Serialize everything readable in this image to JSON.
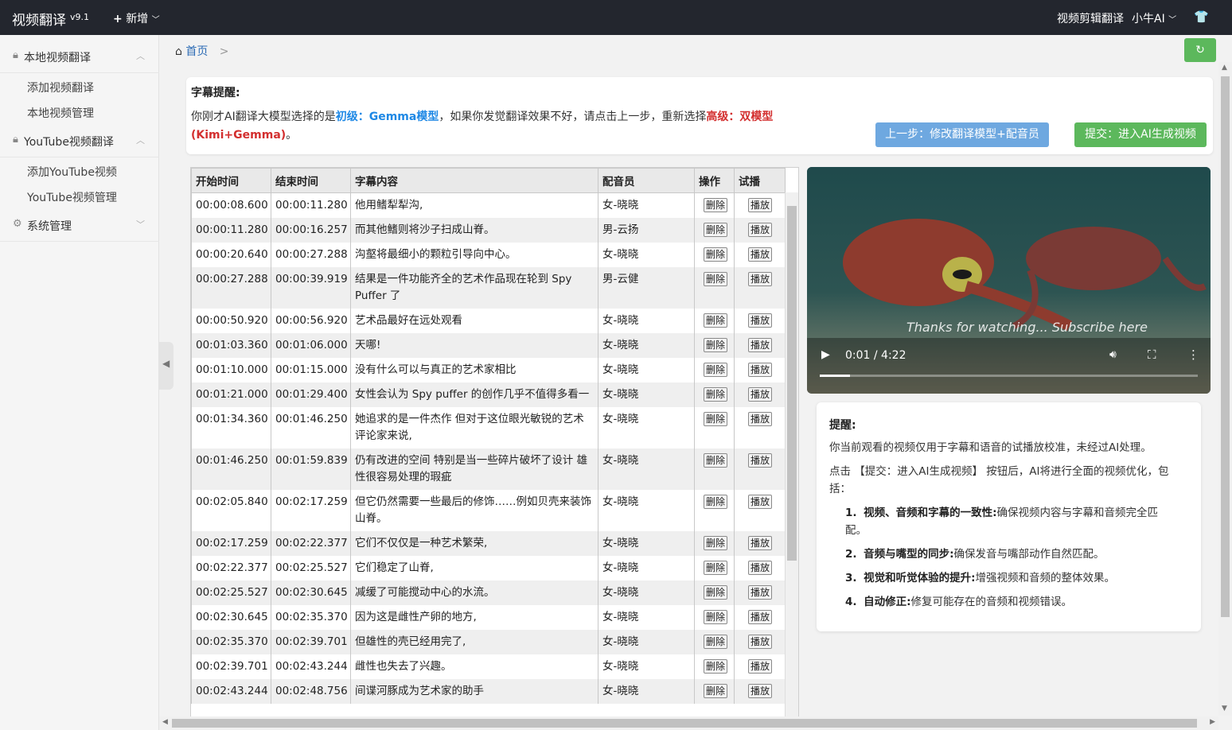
{
  "topbar": {
    "brand": "视频翻译",
    "version": "v9.1",
    "new_label": "新增",
    "right_link": "视频剪辑翻译",
    "user": "小牛AI"
  },
  "sidebar": {
    "groups": [
      {
        "label": "本地视频翻译",
        "items": [
          "添加视频翻译",
          "本地视频管理"
        ]
      },
      {
        "label": "YouTube视频翻译",
        "items": [
          "添加YouTube视频",
          "YouTube视频管理"
        ]
      },
      {
        "label": "系统管理",
        "items": []
      }
    ]
  },
  "breadcrumb": {
    "home": "首页"
  },
  "notice": {
    "title": "字幕提醒:",
    "text_a": "你刚才AI翻译大模型选择的是",
    "level1": "初级：Gemma模型",
    "text_b": "，如果你发觉翻译效果不好，请点击上一步，重新选择",
    "level2": "高级：双模型(Kimi+Gemma)",
    "text_c": "。"
  },
  "buttons": {
    "prev": "上一步：修改翻译模型+配音员",
    "submit": "提交：进入AI生成视频"
  },
  "table": {
    "headers": [
      "开始时间",
      "结束时间",
      "字幕内容",
      "配音员",
      "操作",
      "试播"
    ],
    "delete_label": "删除",
    "play_label": "播放",
    "rows": [
      {
        "start": "00:00:08.600",
        "end": "00:00:11.280",
        "text": "他用鳍犁犁沟,",
        "voice": "女-晓晓"
      },
      {
        "start": "00:00:11.280",
        "end": "00:00:16.257",
        "text": "而其他鳍则将沙子扫成山脊。",
        "voice": "男-云扬"
      },
      {
        "start": "00:00:20.640",
        "end": "00:00:27.288",
        "text": "沟壑将最细小的颗粒引导向中心。",
        "voice": "女-晓晓"
      },
      {
        "start": "00:00:27.288",
        "end": "00:00:39.919",
        "text": "  结果是一件功能齐全的艺术作品现在轮到 Spy Puffer 了",
        "voice": "男-云健"
      },
      {
        "start": "00:00:50.920",
        "end": "00:00:56.920",
        "text": "艺术品最好在远处观看",
        "voice": "女-晓晓"
      },
      {
        "start": "00:01:03.360",
        "end": "00:01:06.000",
        "text": "天哪!",
        "voice": "女-晓晓"
      },
      {
        "start": "00:01:10.000",
        "end": "00:01:15.000",
        "text": "没有什么可以与真正的艺术家相比",
        "voice": "女-晓晓"
      },
      {
        "start": "00:01:21.000",
        "end": "00:01:29.400",
        "text": "女性会认为 Spy puffer 的创作几乎不值得多看一",
        "voice": "女-晓晓"
      },
      {
        "start": "00:01:34.360",
        "end": "00:01:46.250",
        "text": "她追求的是一件杰作 但对于这位眼光敏锐的艺术评论家来说,",
        "voice": "女-晓晓"
      },
      {
        "start": "00:01:46.250",
        "end": "00:01:59.839",
        "text": "仍有改进的空间 特别是当一些碎片破坏了设计 雄性很容易处理的瑕疵",
        "voice": "女-晓晓"
      },
      {
        "start": "00:02:05.840",
        "end": "00:02:17.259",
        "text": "但它仍然需要一些最后的修饰……例如贝壳来装饰山脊。",
        "voice": "女-晓晓"
      },
      {
        "start": "00:02:17.259",
        "end": "00:02:22.377",
        "text": "它们不仅仅是一种艺术繁荣,",
        "voice": "女-晓晓"
      },
      {
        "start": "00:02:22.377",
        "end": "00:02:25.527",
        "text": "它们稳定了山脊,",
        "voice": "女-晓晓"
      },
      {
        "start": "00:02:25.527",
        "end": "00:02:30.645",
        "text": "减缓了可能搅动中心的水流。",
        "voice": "女-晓晓"
      },
      {
        "start": "00:02:30.645",
        "end": "00:02:35.370",
        "text": "因为这是雌性产卵的地方,",
        "voice": "女-晓晓"
      },
      {
        "start": "00:02:35.370",
        "end": "00:02:39.701",
        "text": "但雄性的壳已经用完了,",
        "voice": "女-晓晓"
      },
      {
        "start": "00:02:39.701",
        "end": "00:02:43.244",
        "text": "雌性也失去了兴趣。",
        "voice": "女-晓晓"
      },
      {
        "start": "00:02:43.244",
        "end": "00:02:48.756",
        "text": "  间谍河豚成为艺术家的助手",
        "voice": "女-晓晓"
      }
    ]
  },
  "video": {
    "subtitle_overlay": "Thanks for watching... Subscribe here",
    "time": "0:01 / 4:22",
    "progress": 0.08
  },
  "reminder": {
    "title": "提醒:",
    "p1": "你当前观看的视频仅用于字幕和语音的试播放校准，未经过AI处理。",
    "p2": "点击 【提交：进入AI生成视频】 按钮后，AI将进行全面的视频优化，包括：",
    "items": [
      {
        "num": "1.",
        "bold": "视频、音频和字幕的一致性:",
        "text": "确保视频内容与字幕和音频完全匹配。"
      },
      {
        "num": "2.",
        "bold": "音频与嘴型的同步:",
        "text": "确保发音与嘴部动作自然匹配。"
      },
      {
        "num": "3.",
        "bold": "视觉和听觉体验的提升:",
        "text": "增强视频和音频的整体效果。"
      },
      {
        "num": "4.",
        "bold": "自动修正:",
        "text": "修复可能存在的音频和视频错误。"
      }
    ]
  },
  "colors": {
    "primary_blue": "#6ea8e0",
    "success_green": "#5cb85c",
    "topbar": "#23262e",
    "accent_red": "#d32f2f"
  }
}
